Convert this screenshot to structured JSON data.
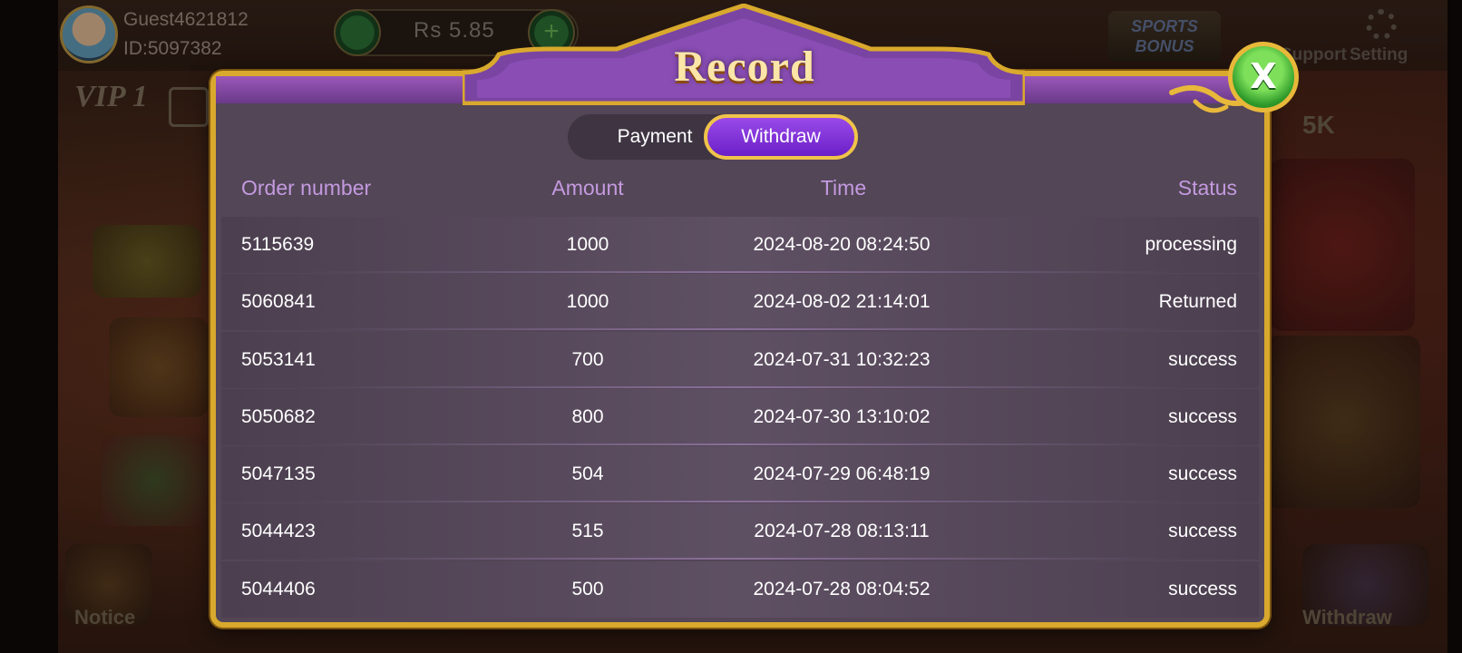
{
  "background": {
    "user": {
      "name": "Guest4621812",
      "id": "ID:5097382"
    },
    "balance": "Rs  5.85",
    "add_symbol": "+",
    "vip": "VIP 1",
    "sports_bonus": "SPORTS BONUS",
    "support_label": "Support",
    "setting_label": "Setting",
    "label_5k": "5K",
    "notice_label": "Notice",
    "withdraw_label": "Withdraw"
  },
  "dialog": {
    "title": "Record",
    "close_symbol": "X",
    "tabs": [
      {
        "label": "Payment",
        "active": false
      },
      {
        "label": "Withdraw",
        "active": true
      }
    ],
    "columns": [
      "Order number",
      "Amount",
      "Time",
      "Status"
    ],
    "rows": [
      {
        "order": "5115639",
        "amount": "1000",
        "time": "2024-08-20 08:24:50",
        "status": "processing"
      },
      {
        "order": "5060841",
        "amount": "1000",
        "time": "2024-08-02 21:14:01",
        "status": "Returned"
      },
      {
        "order": "5053141",
        "amount": "700",
        "time": "2024-07-31 10:32:23",
        "status": "success"
      },
      {
        "order": "5050682",
        "amount": "800",
        "time": "2024-07-30 13:10:02",
        "status": "success"
      },
      {
        "order": "5047135",
        "amount": "504",
        "time": "2024-07-29 06:48:19",
        "status": "success"
      },
      {
        "order": "5044423",
        "amount": "515",
        "time": "2024-07-28 08:13:11",
        "status": "success"
      },
      {
        "order": "5044406",
        "amount": "500",
        "time": "2024-07-28 08:04:52",
        "status": "success"
      }
    ]
  },
  "colors": {
    "accent_gold": "#d9a92d",
    "tab_active": "#7a30d8",
    "header_text": "#c49ae0",
    "panel": "#534656"
  }
}
